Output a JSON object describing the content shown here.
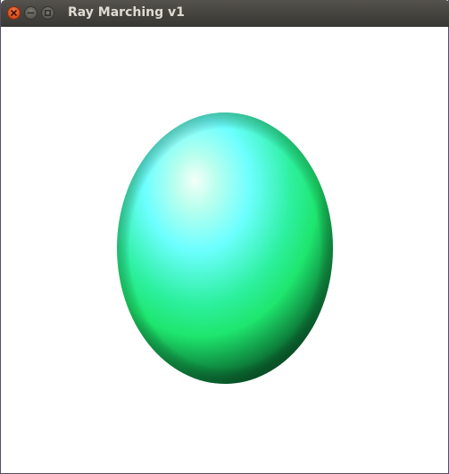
{
  "window": {
    "title": "Ray Marching v1",
    "controls": {
      "close_icon": "close-icon",
      "minimize_icon": "minimize-icon",
      "maximize_icon": "maximize-icon"
    }
  },
  "scene": {
    "object": "sphere",
    "background_color": "#ffffff",
    "sphere_highlight_color": "#6cffff",
    "sphere_body_color": "#1ee66e",
    "sphere_shadow_color": "#000000"
  }
}
